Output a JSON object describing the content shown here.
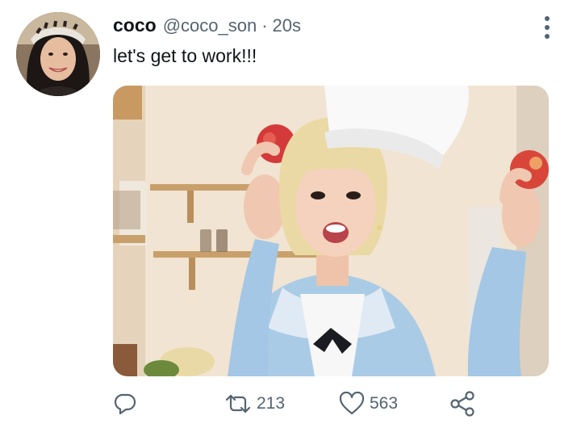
{
  "tweet": {
    "display_name": "coco",
    "handle": "@coco_son",
    "separator": "·",
    "timestamp": "20s",
    "text": "let's get to work!!!"
  },
  "actions": {
    "reply": {
      "icon": "reply-icon",
      "count": ""
    },
    "retweet": {
      "icon": "retweet-icon",
      "count": "213"
    },
    "like": {
      "icon": "heart-icon",
      "count": "563"
    },
    "share": {
      "icon": "share-icon"
    }
  },
  "colors": {
    "text_primary": "#0f1419",
    "text_secondary": "#536471",
    "background": "#ffffff"
  }
}
